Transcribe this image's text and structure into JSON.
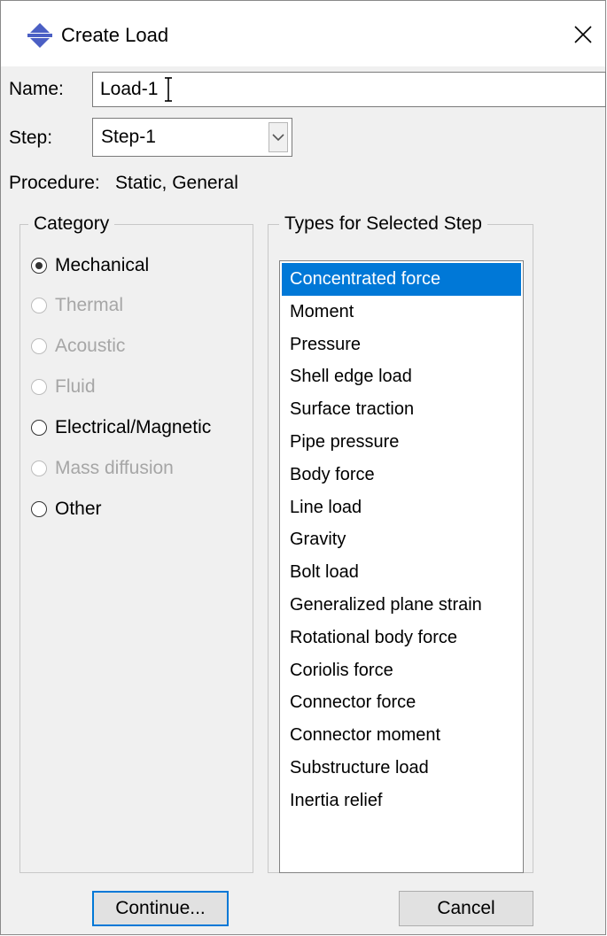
{
  "window": {
    "title": "Create Load",
    "icon": "abaqus-load-icon",
    "close_icon": "close-icon"
  },
  "name": {
    "label": "Name:",
    "value": "Load-1"
  },
  "step": {
    "label": "Step:",
    "selected": "Step-1"
  },
  "procedure": {
    "label": "Procedure:",
    "value": "Static, General"
  },
  "category": {
    "legend": "Category",
    "options": [
      {
        "label": "Mechanical",
        "checked": true,
        "enabled": true
      },
      {
        "label": "Thermal",
        "checked": false,
        "enabled": false
      },
      {
        "label": "Acoustic",
        "checked": false,
        "enabled": false
      },
      {
        "label": "Fluid",
        "checked": false,
        "enabled": false
      },
      {
        "label": "Electrical/Magnetic",
        "checked": false,
        "enabled": true
      },
      {
        "label": "Mass diffusion",
        "checked": false,
        "enabled": false
      },
      {
        "label": "Other",
        "checked": false,
        "enabled": true
      }
    ]
  },
  "types": {
    "legend": "Types for Selected Step",
    "selected_index": 0,
    "items": [
      "Concentrated force",
      "Moment",
      "Pressure",
      "Shell edge load",
      "Surface traction",
      "Pipe pressure",
      "Body force",
      "Line load",
      "Gravity",
      "Bolt load",
      "Generalized plane strain",
      "Rotational body force",
      "Coriolis force",
      "Connector force",
      "Connector moment",
      "Substructure load",
      "Inertia relief"
    ]
  },
  "buttons": {
    "continue": "Continue...",
    "cancel": "Cancel"
  },
  "colors": {
    "selection": "#0078d7",
    "dialog_bg": "#f0f0f0",
    "disabled_text": "#a6a6a6"
  }
}
